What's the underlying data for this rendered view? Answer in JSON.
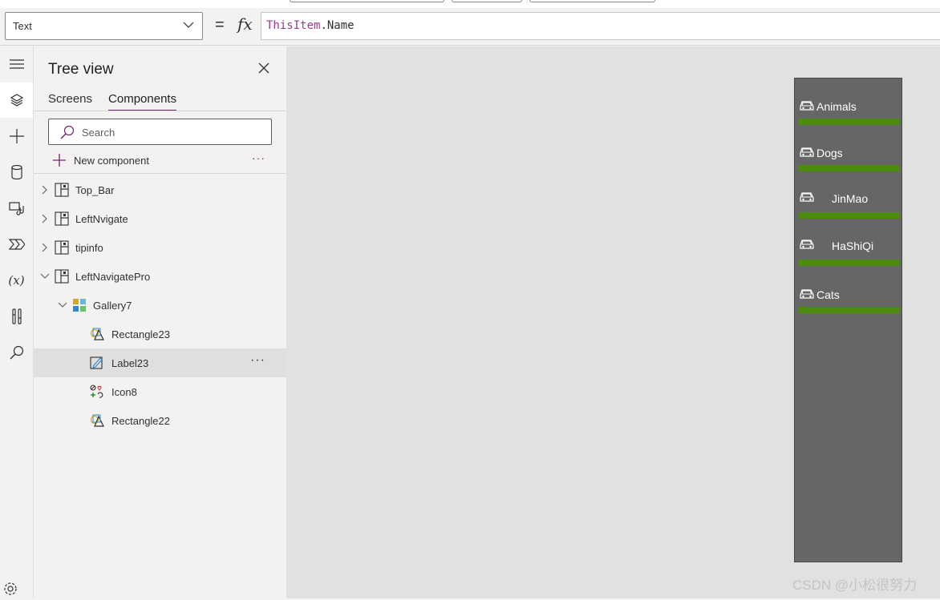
{
  "formula_bar": {
    "property": "Text",
    "equals": "=",
    "fx": "fx",
    "formula_keyword": "ThisItem",
    "formula_rest": ".Name"
  },
  "tree_view": {
    "title": "Tree view",
    "tabs": [
      "Screens",
      "Components"
    ],
    "active_tab": "Components",
    "search_placeholder": "Search",
    "new_component_label": "New component",
    "more": "···",
    "nodes": [
      {
        "label": "Top_Bar",
        "type": "component",
        "level": 0,
        "expanded": false
      },
      {
        "label": "LeftNvigate",
        "type": "component",
        "level": 0,
        "expanded": false
      },
      {
        "label": "tipinfo",
        "type": "component",
        "level": 0,
        "expanded": false
      },
      {
        "label": "LeftNavigatePro",
        "type": "component",
        "level": 0,
        "expanded": true
      },
      {
        "label": "Gallery7",
        "type": "gallery",
        "level": 1,
        "expanded": true
      },
      {
        "label": "Rectangle23",
        "type": "shape",
        "level": 2
      },
      {
        "label": "Label23",
        "type": "label",
        "level": 2,
        "selected": true
      },
      {
        "label": "Icon8",
        "type": "icon",
        "level": 2
      },
      {
        "label": "Rectangle22",
        "type": "shape",
        "level": 2
      }
    ]
  },
  "canvas": {
    "gallery_items": [
      "Animals",
      "Dogs",
      "JinMao",
      "HaShiQi",
      "Cats"
    ],
    "item_bar_color": "#4b8c0c",
    "component_bg": "#666666"
  },
  "watermark": "CSDN @小松很努力",
  "accent_color": "#742774"
}
